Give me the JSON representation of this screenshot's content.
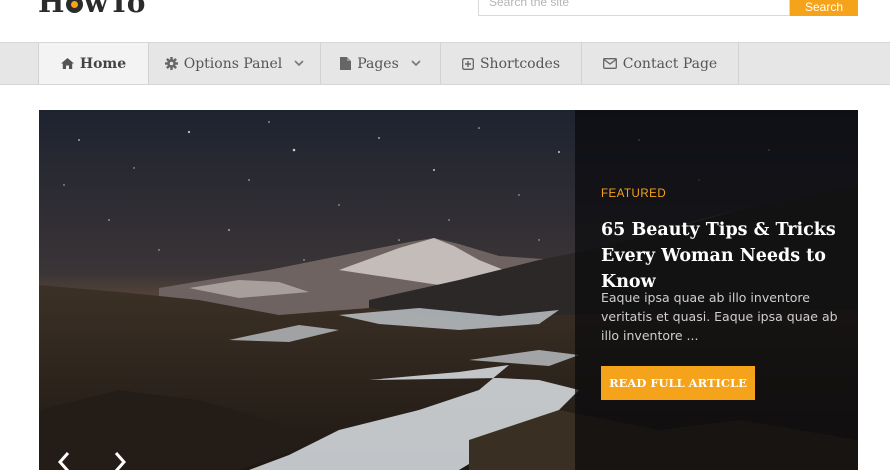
{
  "header": {
    "logo": {
      "left": "H",
      "right": "wTo"
    },
    "search": {
      "placeholder": "Search the site",
      "button_label": "Search"
    }
  },
  "nav": {
    "items": [
      {
        "label": "Home",
        "icon": "home-icon",
        "dropdown": false,
        "active": true
      },
      {
        "label": "Options Panel",
        "icon": "gear-icon",
        "dropdown": true,
        "active": false
      },
      {
        "label": "Pages",
        "icon": "file-icon",
        "dropdown": true,
        "active": false
      },
      {
        "label": "Shortcodes",
        "icon": "plus-square-icon",
        "dropdown": false,
        "active": false
      },
      {
        "label": "Contact Page",
        "icon": "envelope-icon",
        "dropdown": false,
        "active": false
      }
    ]
  },
  "slider": {
    "tag": "FEATURED",
    "title": "65 Beauty Tips & Tricks Every Woman Needs to Know",
    "excerpt": "Eaque ipsa quae ab illo inventore veritatis et quasi. Eaque ipsa quae ab illo inventore ...",
    "cta_label": "READ FULL ARTICLE",
    "image_alt": "night sky over snowy mountains"
  },
  "colors": {
    "accent": "#f5a31a",
    "navbar_bg": "#e6e6e6",
    "text_dark": "#2b2b2b"
  }
}
